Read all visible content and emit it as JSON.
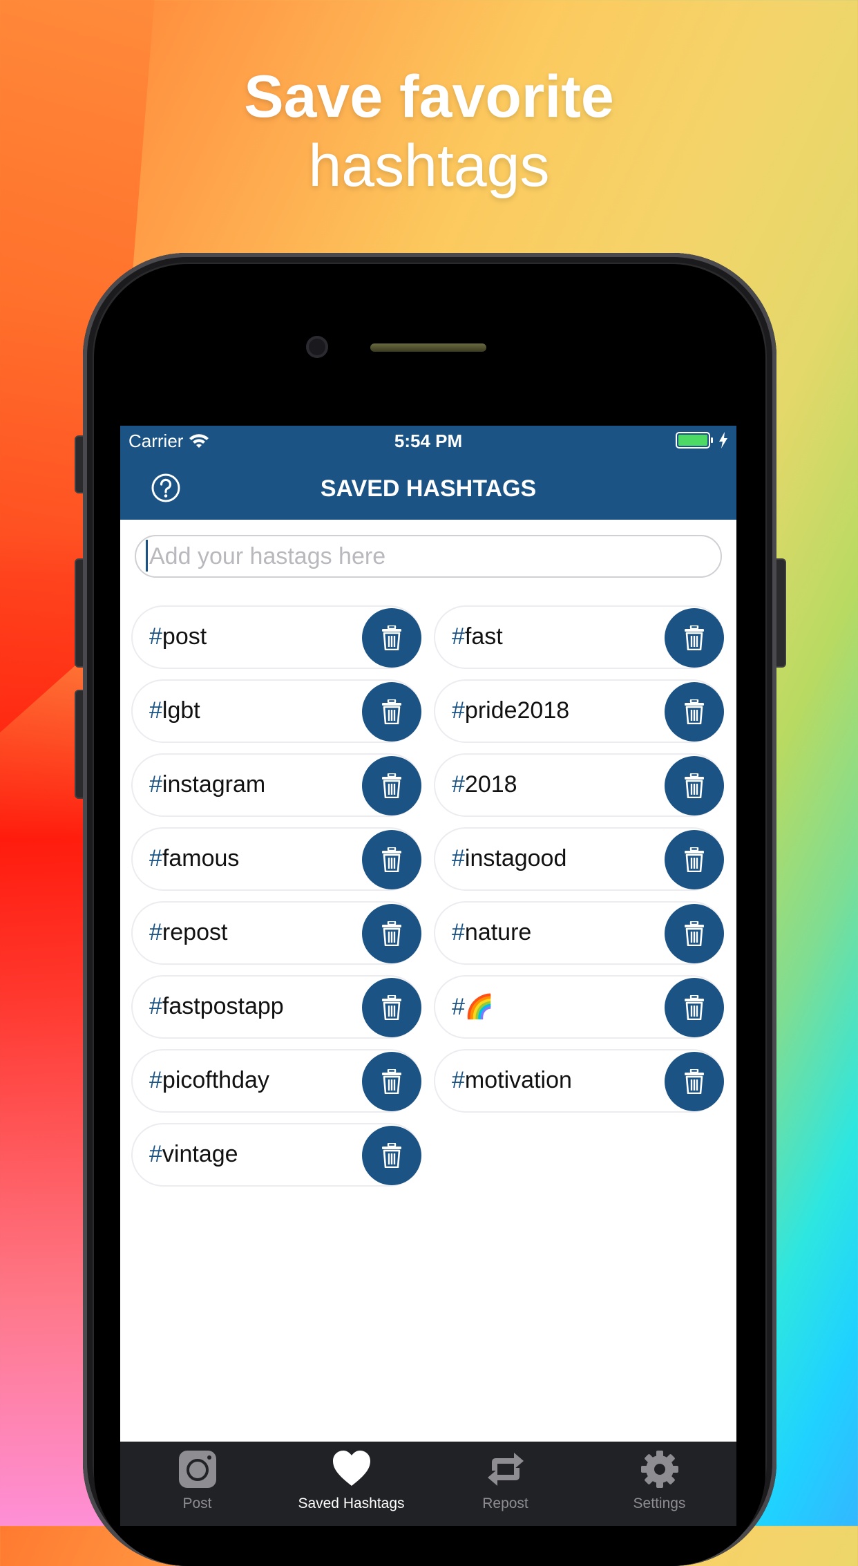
{
  "headline": {
    "line1": "Save favorite",
    "line2": "hashtags"
  },
  "status_bar": {
    "carrier": "Carrier",
    "time": "5:54 PM"
  },
  "nav": {
    "title": "SAVED HASHTAGS",
    "help_icon": "question-circle-icon"
  },
  "search": {
    "placeholder": "Add your hastags here",
    "value": ""
  },
  "hashtags": [
    "post",
    "fast",
    "lgbt",
    "pride2018",
    "instagram",
    "2018",
    "famous",
    "instagood",
    "repost",
    "nature",
    "fastpostapp",
    "🌈",
    "picofthday",
    "motivation",
    "vintage"
  ],
  "hash_symbol": "#",
  "tabs": [
    {
      "label": "Post",
      "icon": "camera-icon",
      "active": false
    },
    {
      "label": "Saved Hashtags",
      "icon": "heart-icon",
      "active": true
    },
    {
      "label": "Repost",
      "icon": "repost-icon",
      "active": false
    },
    {
      "label": "Settings",
      "icon": "gear-icon",
      "active": false
    }
  ],
  "colors": {
    "accent": "#1b5385",
    "tabbar": "#212225",
    "inactive_tab": "#8d8d92"
  }
}
